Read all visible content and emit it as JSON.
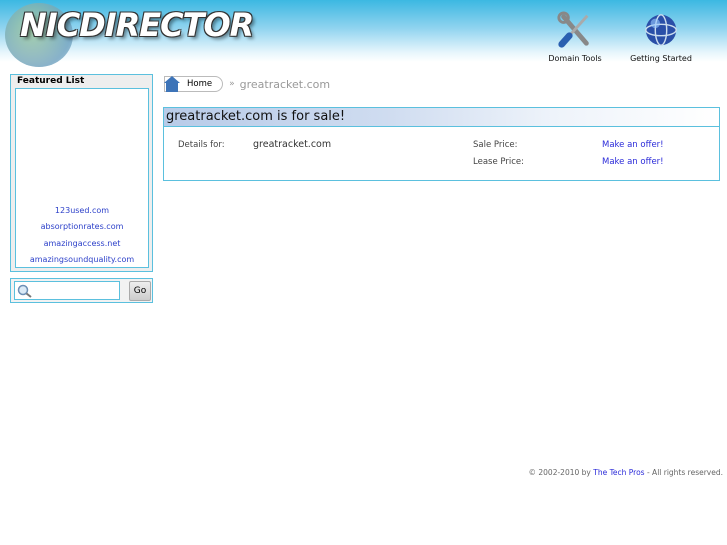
{
  "header": {
    "logo": "NICDIRECTOR",
    "nav": [
      {
        "label": "Domain Tools",
        "icon": "tools-icon"
      },
      {
        "label": "Getting Started",
        "icon": "globe-icon"
      }
    ]
  },
  "sidebar": {
    "featured_title": "Featured List",
    "featured": [
      "123used.com",
      "absorptionrates.com",
      "amazingaccess.net",
      "amazingsoundquality.com"
    ],
    "search_placeholder": "",
    "go_label": "Go"
  },
  "breadcrumb": {
    "home": "Home",
    "separator": "»",
    "current": "greatracket.com"
  },
  "panel": {
    "title": "greatracket.com is for sale!",
    "details_label": "Details for:",
    "domain": "greatracket.com",
    "sale_label": "Sale Price:",
    "sale_value": "Make an offer!",
    "lease_label": "Lease Price:",
    "lease_value": "Make an offer!"
  },
  "footer": {
    "prefix": "© 2002-2010 by",
    "link": "The Tech Pros",
    "suffix": "- All rights reserved."
  }
}
